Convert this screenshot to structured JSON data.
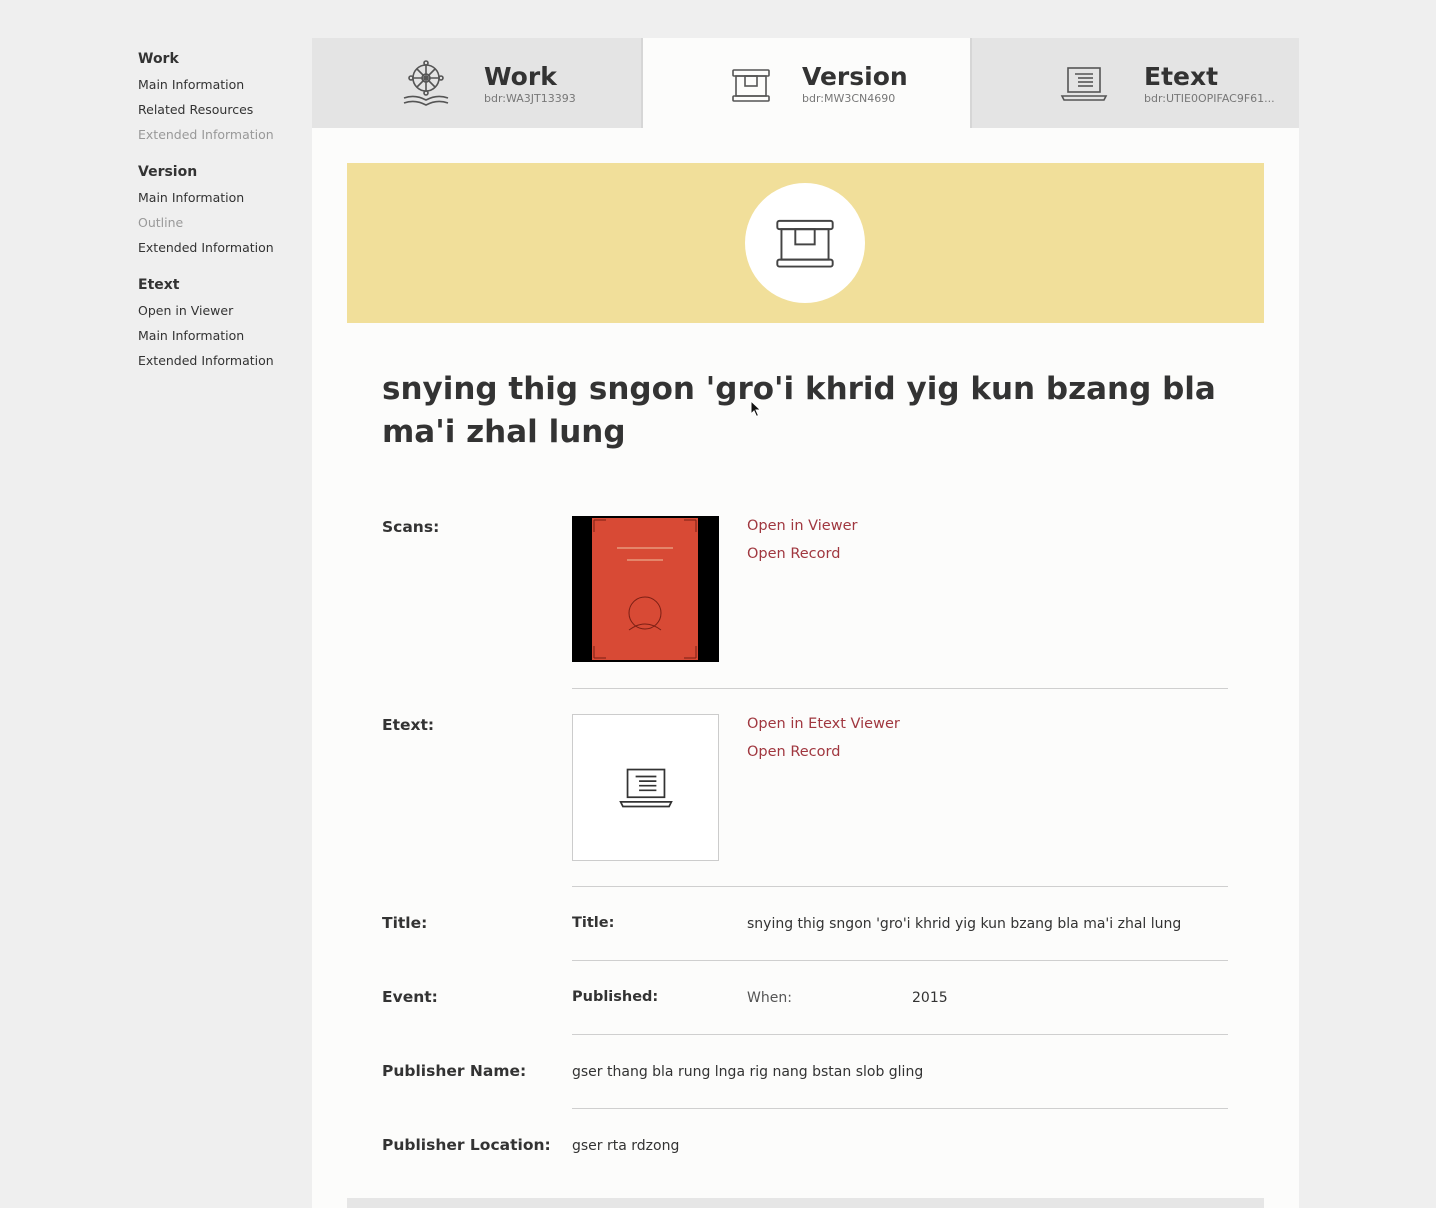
{
  "sidebar": {
    "groups": [
      {
        "heading": "Work",
        "items": [
          "Main Information",
          "Related Resources",
          "Extended Information"
        ]
      },
      {
        "heading": "Version",
        "items": [
          "Main Information",
          "Outline",
          "Extended Information"
        ]
      },
      {
        "heading": "Etext",
        "items": [
          "Open in Viewer",
          "Main Information",
          "Extended Information"
        ]
      }
    ]
  },
  "tabs": [
    {
      "title": "Work",
      "id": "bdr:WA3JT13393",
      "icon": "dharma-wheel-book-icon"
    },
    {
      "title": "Version",
      "id": "bdr:MW3CN4690",
      "icon": "pecha-box-icon"
    },
    {
      "title": "Etext",
      "id": "bdr:UTIE0OPIFAC9F61...",
      "icon": "laptop-icon"
    }
  ],
  "banner": {
    "icon": "pecha-box-icon",
    "color": "#f1df9a"
  },
  "main": {
    "title": "snying thig sngon 'gro'i khrid yig kun bzang bla ma'i zhal lung",
    "scans": {
      "label": "Scans:",
      "links": [
        "Open in Viewer",
        "Open Record"
      ]
    },
    "etext": {
      "label": "Etext:",
      "links": [
        "Open in Etext Viewer",
        "Open Record"
      ],
      "icon": "laptop-icon"
    },
    "title_row": {
      "label": "Title:",
      "sublabel": "Title:",
      "value": "snying thig sngon 'gro'i khrid yig kun bzang bla ma'i zhal lung"
    },
    "event_row": {
      "label": "Event:",
      "sublabel": "Published:",
      "when_label": "When:",
      "when_value": "2015"
    },
    "publisher_name": {
      "label": "Publisher Name:",
      "value": "gser thang bla rung lnga rig nang bstan slob gling"
    },
    "publisher_location": {
      "label": "Publisher Location:",
      "value": "gser rta rdzong"
    }
  },
  "colors": {
    "link": "#a0373f",
    "accent_banner": "#f1df9a",
    "background": "#efefef"
  }
}
